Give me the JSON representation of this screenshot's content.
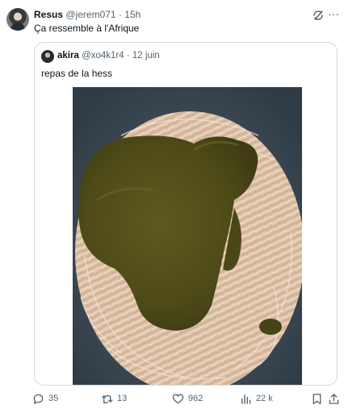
{
  "tweet": {
    "display_name": "Resus",
    "handle": "@jerem071",
    "separator": "·",
    "time": "15h",
    "text": "Ça ressemble à l'Afrique",
    "more": "···"
  },
  "quote": {
    "display_name": "akira",
    "handle": "@xo4k1r4",
    "separator": "·",
    "date": "12 juin",
    "text": "repas de la hess"
  },
  "actions": {
    "replies": "35",
    "retweets": "13",
    "likes": "962",
    "views": "22 k"
  },
  "colors": {
    "text": "#0f1419",
    "secondary": "#536471",
    "border": "#cfd9de"
  }
}
